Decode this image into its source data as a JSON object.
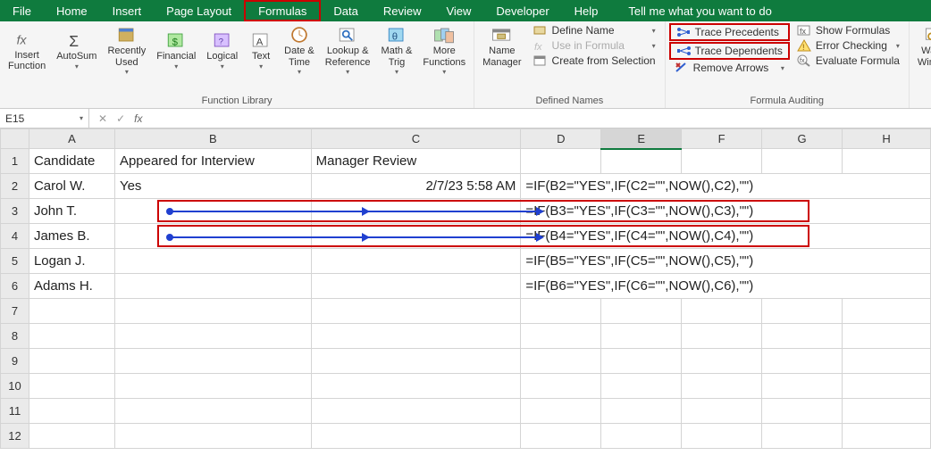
{
  "tabs": {
    "file": "File",
    "home": "Home",
    "insert": "Insert",
    "pagelayout": "Page Layout",
    "formulas": "Formulas",
    "data": "Data",
    "review": "Review",
    "view": "View",
    "developer": "Developer",
    "help": "Help",
    "tell": "Tell me what you want to do"
  },
  "ribbon": {
    "insertfn": "Insert\nFunction",
    "autosum": "AutoSum",
    "recently": "Recently\nUsed",
    "financial": "Financial",
    "logical": "Logical",
    "text": "Text",
    "datetime": "Date &\nTime",
    "lookup": "Lookup &\nReference",
    "mathtrig": "Math &\nTrig",
    "more": "More\nFunctions",
    "fnlib": "Function Library",
    "namemgr": "Name\nManager",
    "define": "Define Name",
    "usein": "Use in Formula",
    "createsel": "Create from Selection",
    "definednames": "Defined Names",
    "traceprec": "Trace Precedents",
    "tracedep": "Trace Dependents",
    "removearr": "Remove Arrows",
    "showfm": "Show Formulas",
    "errchk": "Error Checking",
    "evalfm": "Evaluate Formula",
    "fmaudit": "Formula Auditing",
    "watch": "Watch\nWindow"
  },
  "namebox": "E15",
  "colhdr": {
    "A": "A",
    "B": "B",
    "C": "C",
    "D": "D",
    "E": "E",
    "F": "F",
    "G": "G",
    "H": "H"
  },
  "rows": {
    "1": {
      "A": "Candidate",
      "B": "Appeared for Interview",
      "C": "Manager Review"
    },
    "2": {
      "A": "Carol W.",
      "B": "Yes",
      "C": "2/7/23 5:58 AM",
      "D": "=IF(B2=\"YES\",IF(C2=\"\",NOW(),C2),\"\")"
    },
    "3": {
      "A": "John T.",
      "D": "=IF(B3=\"YES\",IF(C3=\"\",NOW(),C3),\"\")"
    },
    "4": {
      "A": "James B.",
      "D": "=IF(B4=\"YES\",IF(C4=\"\",NOW(),C4),\"\")"
    },
    "5": {
      "A": "Logan J.",
      "D": "=IF(B5=\"YES\",IF(C5=\"\",NOW(),C5),\"\")"
    },
    "6": {
      "A": "Adams H.",
      "D": "=IF(B6=\"YES\",IF(C6=\"\",NOW(),C6),\"\")"
    }
  }
}
